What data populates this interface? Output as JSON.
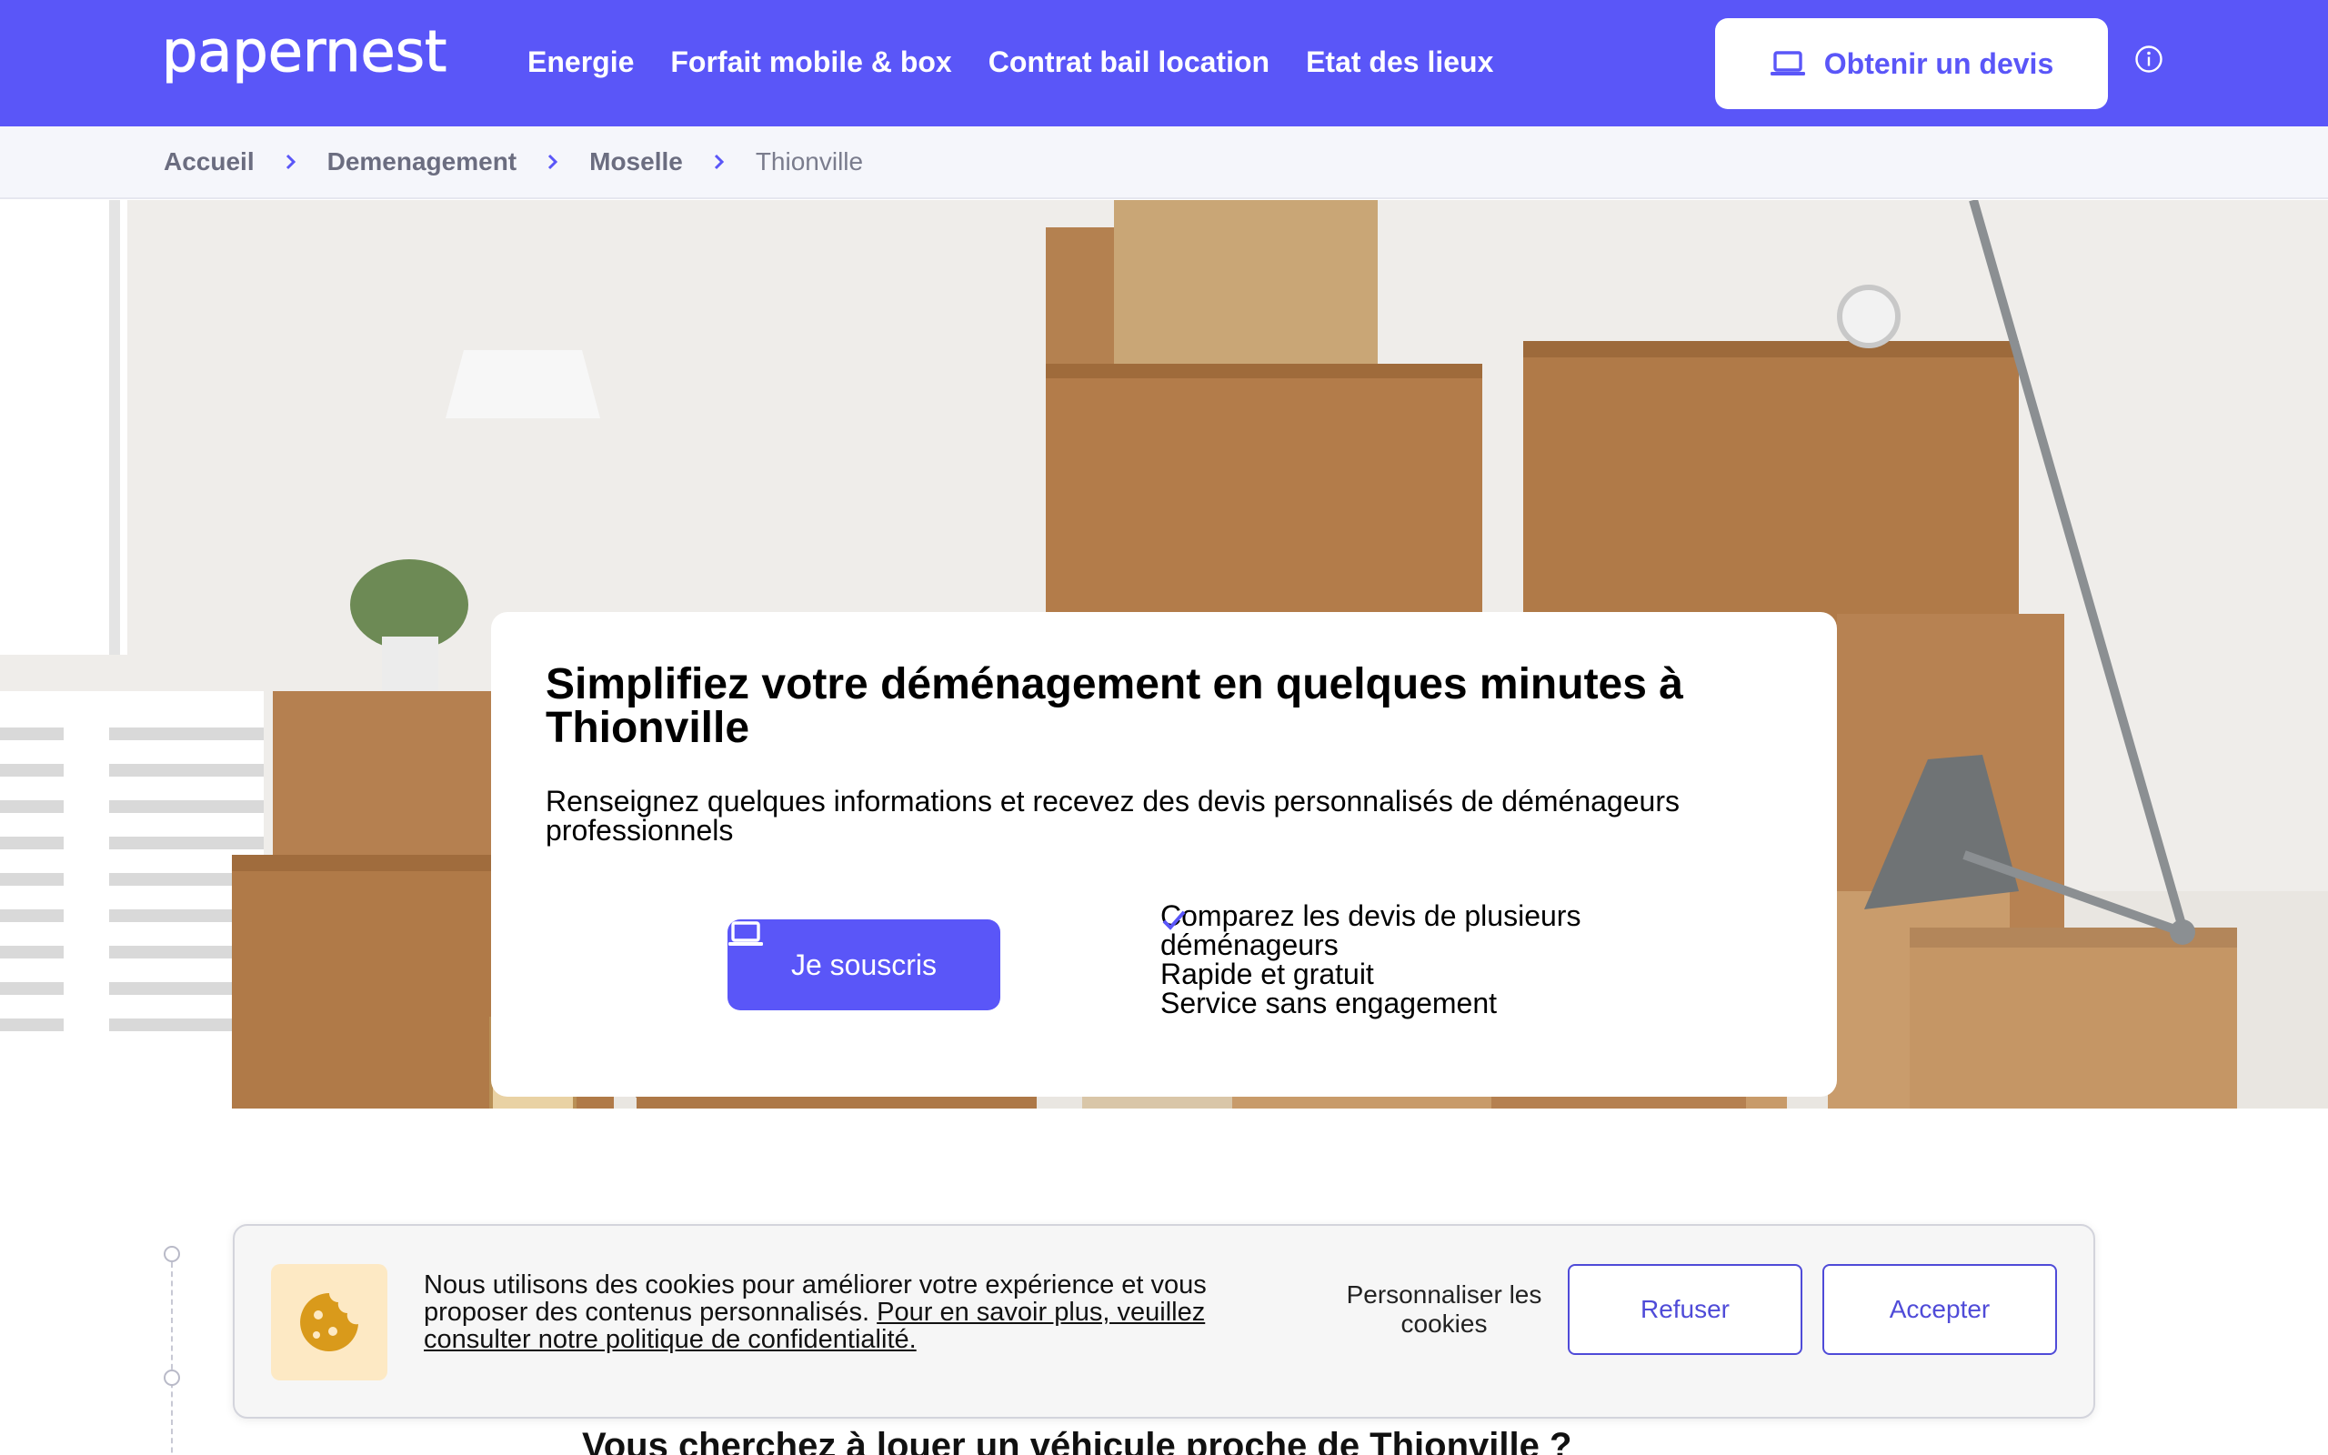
{
  "header": {
    "logo_text": "papernest",
    "nav": [
      "Energie",
      "Forfait mobile & box",
      "Contrat bail location",
      "Etat des lieux"
    ],
    "quote_button_label": "Obtenir un devis",
    "quote_button_icon": "laptop-icon",
    "info_icon": "info-icon",
    "background_color": "#5a56f8"
  },
  "breadcrumb": {
    "items": [
      "Accueil",
      "Demenagement",
      "Moselle",
      "Thionville"
    ],
    "separator_icon": "chevron-right-icon"
  },
  "hero": {
    "title": "Simplifiez votre déménagement en quelques minutes à Thionville",
    "subtitle": "Renseignez quelques informations et recevez des devis personnalisés de déménageurs professionnels",
    "cta_label": "Je souscris",
    "cta_icon": "laptop-icon",
    "features": [
      "Comparez les devis de plusieurs déménageurs",
      "Rapide et gratuit",
      "Service sans engagement"
    ],
    "feature_icon": "check-icon"
  },
  "content": {
    "section_title": "Vous cherchez à louer un véhicule proche de Thionville ?"
  },
  "cookie_banner": {
    "icon": "cookie-icon",
    "text": "Nous utilisons des cookies pour améliorer votre expérience et vous proposer des contenus personnalisés.",
    "link_text": "Pour en savoir plus, veuillez consulter notre politique de confidentialité.",
    "personalize_label": "Personnaliser les cookies",
    "refuse_label": "Refuser",
    "accept_label": "Accepter"
  },
  "colors": {
    "brand": "#5a56f8",
    "cookie_accent": "#4f4bd8",
    "cookie_icon_bg": "#fde9c4"
  }
}
